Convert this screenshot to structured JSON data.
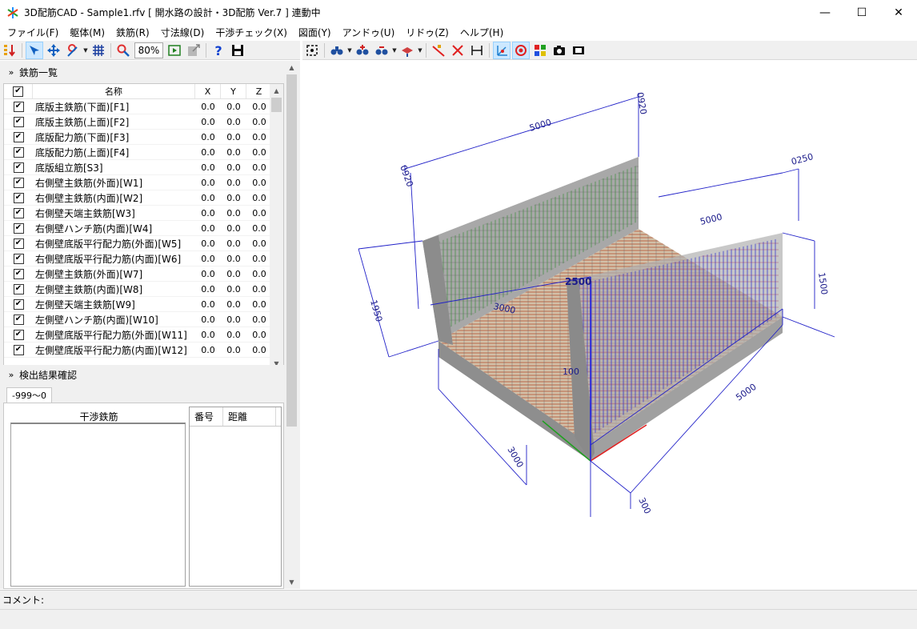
{
  "window": {
    "title": "3D配筋CAD - Sample1.rfv [ 開水路の設計・3D配筋 Ver.7 ] 連動中",
    "minimize": "—",
    "maximize": "☐",
    "close": "✕"
  },
  "menu": [
    "ファイル(F)",
    "躯体(M)",
    "鉄筋(R)",
    "寸法線(D)",
    "干渉チェック(X)",
    "図面(Y)",
    "アンドゥ(U)",
    "リドゥ(Z)",
    "ヘルプ(H)"
  ],
  "toolbar": {
    "zoom": "80%"
  },
  "rebar_panel": {
    "title": "鉄筋一覧",
    "columns": {
      "check": "☑",
      "name": "名称",
      "x": "X",
      "y": "Y",
      "z": "Z"
    },
    "rows": [
      {
        "name": "底版主鉄筋(下面)[F1]",
        "x": "0.0",
        "y": "0.0",
        "z": "0.0"
      },
      {
        "name": "底版主鉄筋(上面)[F2]",
        "x": "0.0",
        "y": "0.0",
        "z": "0.0"
      },
      {
        "name": "底版配力筋(下面)[F3]",
        "x": "0.0",
        "y": "0.0",
        "z": "0.0"
      },
      {
        "name": "底版配力筋(上面)[F4]",
        "x": "0.0",
        "y": "0.0",
        "z": "0.0"
      },
      {
        "name": "底版組立筋[S3]",
        "x": "0.0",
        "y": "0.0",
        "z": "0.0"
      },
      {
        "name": "右側壁主鉄筋(外面)[W1]",
        "x": "0.0",
        "y": "0.0",
        "z": "0.0"
      },
      {
        "name": "右側壁主鉄筋(内面)[W2]",
        "x": "0.0",
        "y": "0.0",
        "z": "0.0"
      },
      {
        "name": "右側壁天端主鉄筋[W3]",
        "x": "0.0",
        "y": "0.0",
        "z": "0.0"
      },
      {
        "name": "右側壁ハンチ筋(内面)[W4]",
        "x": "0.0",
        "y": "0.0",
        "z": "0.0"
      },
      {
        "name": "右側壁底版平行配力筋(外面)[W5]",
        "x": "0.0",
        "y": "0.0",
        "z": "0.0"
      },
      {
        "name": "右側壁底版平行配力筋(内面)[W6]",
        "x": "0.0",
        "y": "0.0",
        "z": "0.0"
      },
      {
        "name": "左側壁主鉄筋(外面)[W7]",
        "x": "0.0",
        "y": "0.0",
        "z": "0.0"
      },
      {
        "name": "左側壁主鉄筋(内面)[W8]",
        "x": "0.0",
        "y": "0.0",
        "z": "0.0"
      },
      {
        "name": "左側壁天端主鉄筋[W9]",
        "x": "0.0",
        "y": "0.0",
        "z": "0.0"
      },
      {
        "name": "左側壁ハンチ筋(内面)[W10]",
        "x": "0.0",
        "y": "0.0",
        "z": "0.0"
      },
      {
        "name": "左側壁底版平行配力筋(外面)[W11]",
        "x": "0.0",
        "y": "0.0",
        "z": "0.0"
      },
      {
        "name": "左側壁底版平行配力筋(内面)[W12]",
        "x": "0.0",
        "y": "0.0",
        "z": "0.0"
      }
    ]
  },
  "detect_panel": {
    "title": "検出結果確認",
    "tab": "-999〜0",
    "interference_label": "干渉鉄筋",
    "col_number": "番号",
    "col_distance": "距離"
  },
  "dimensions": {
    "top_length": "5000",
    "top_right": "0920",
    "left_height": "1950",
    "left_small": "0920",
    "middle_length": "3000",
    "middle_right": "5000",
    "right_top": "0250",
    "right_height": "1500",
    "center_height": "2500",
    "front_length": "5000",
    "front_small": "300",
    "front_bottom": "3000",
    "small_100": "100"
  },
  "status": {
    "comment_label": "コメント:"
  }
}
